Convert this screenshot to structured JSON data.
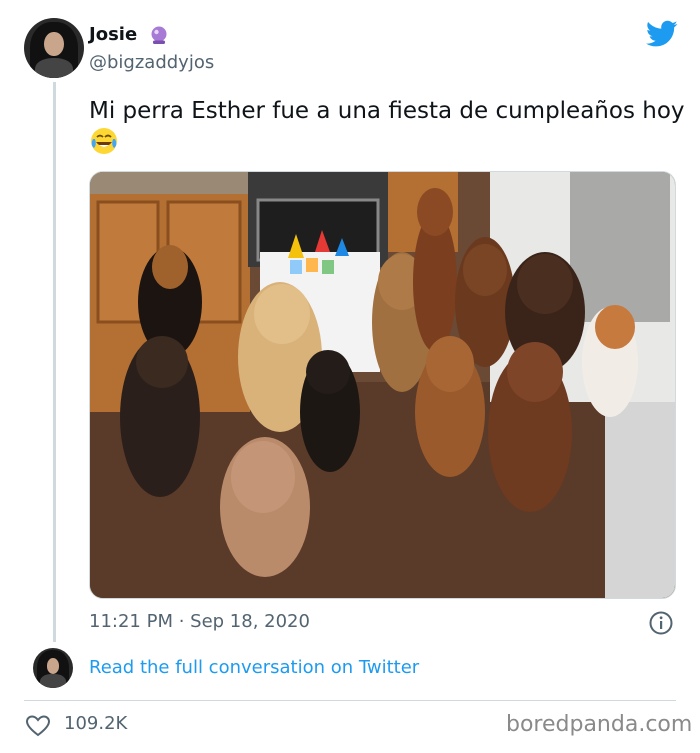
{
  "tweet": {
    "author": {
      "display_name": "Josie",
      "handle": "@bigzaddyjos",
      "badge_icon": "crystal-ball-icon",
      "avatar": "profile-photo"
    },
    "text": "Mi perra Esther fue a una fiesta de cumpleaños hoy",
    "emoji": "tears-of-joy-icon",
    "timestamp": "11:21 PM · Sep 18, 2020",
    "read_conversation_link": "Read the full conversation on Twitter",
    "likes": "109.2K",
    "brand_icon": "twitter-bird-icon"
  },
  "watermark": "boredpanda.com",
  "colors": {
    "link": "#1d9bf0",
    "twitter_blue": "#1d9bf0",
    "secondary_text": "#536471",
    "divider": "#cfd9de",
    "watermark": "#8a8a8a"
  }
}
